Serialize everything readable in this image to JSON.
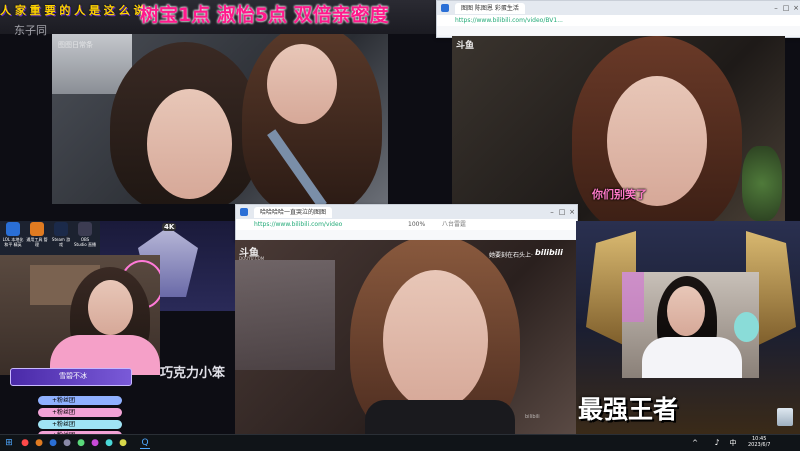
{
  "banner": {
    "left_marquee": "人 家 重 要 的 人 是 这 么 说 的",
    "main": "树宝1点  淑怡5点  双倍亲密度",
    "under": "东子同"
  },
  "top_left_stream": {
    "watermark": "图图日常条"
  },
  "top_right_stream": {
    "tab_title": "图图 陈图恩 彩蛋生活",
    "url": "https://www.bilibili.com/video/BV1...",
    "badge": "斗鱼",
    "subtitle": "你们别笑了"
  },
  "center_browser": {
    "tab_title": "哈哈哈哈一直哭泣的图图",
    "url": "https://www.bilibili.com/video",
    "zoom": "100%",
    "search_placeholder": "八台雷霆",
    "badge": "斗鱼",
    "badge_sub": "DOUYU.COM",
    "top_right_text": "她要刻在石头上·",
    "bilibili": "bilibili",
    "corner_mark": "bilibili"
  },
  "left_panel": {
    "desktop_icons": [
      {
        "label": "LOL 本地化 和平 精英",
        "color": "#2a6fd6"
      },
      {
        "label": "通用工具 管理",
        "color": "#e07b21"
      },
      {
        "label": "Steam 游戏",
        "color": "#1b2a4a"
      },
      {
        "label": "OBS Studio 直播",
        "color": "#3c3c52"
      }
    ],
    "side_text": "巧克力小笨",
    "badge_4k": "4K",
    "gift_name": "雪碧不冰",
    "bars": [
      {
        "text": "+粉丝团",
        "color": "#8fb0ff"
      },
      {
        "text": "+粉丝团",
        "color": "#f2a2d6"
      },
      {
        "text": "+粉丝团",
        "color": "#9fe3f5"
      },
      {
        "text": "+粉丝团",
        "color": "#f2a2d6"
      }
    ]
  },
  "right_panel": {
    "big_caption": "最强王者"
  },
  "desktop": {
    "recycle_label": "回收站"
  },
  "taskbar": {
    "time": "10:45",
    "date": "2023/6/7",
    "tray_glyphs": [
      "^",
      "♪",
      "中"
    ]
  }
}
